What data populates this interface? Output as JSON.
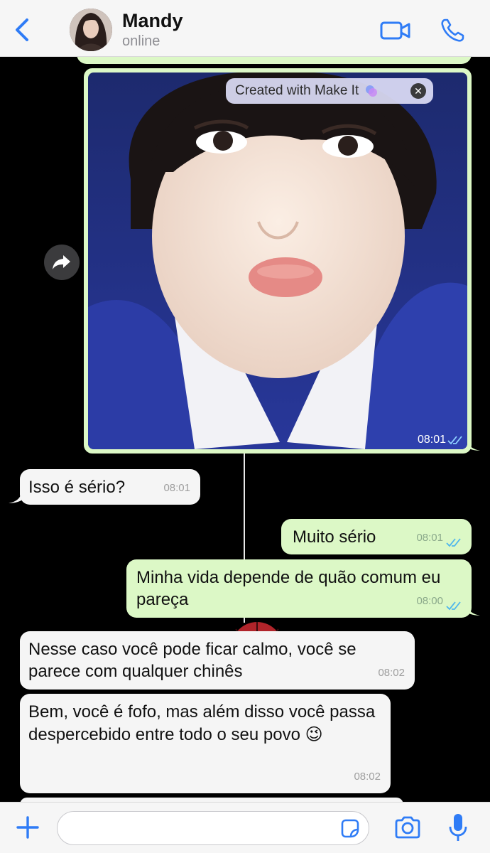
{
  "header": {
    "contact_name": "Mandy",
    "status": "online",
    "back_icon": "chevron-left-icon",
    "video_icon": "video-camera-icon",
    "phone_icon": "phone-icon",
    "accent_color": "#2f7cf6"
  },
  "image_message": {
    "badge_text": "Created with Make It",
    "time": "08:01",
    "status": "read"
  },
  "messages": [
    {
      "direction": "incoming",
      "text": "Isso é sério?",
      "time": "08:01"
    },
    {
      "direction": "outgoing",
      "text": "Muito sério",
      "time": "08:01",
      "status": "read"
    },
    {
      "direction": "outgoing",
      "text": "Minha vida depende de quão comum eu pareça",
      "time": "08:00",
      "status": "read"
    },
    {
      "direction": "incoming",
      "text": "Nesse caso você pode ficar calmo, você se parece com qualquer chinês",
      "time": "08:02"
    },
    {
      "direction": "incoming",
      "text": "Bem, você é fofo, mas além disso você passa despercebido entre todo o seu povo 😉",
      "time": "08:02"
    }
  ],
  "composer": {
    "value": "",
    "plus_icon": "plus-icon",
    "sticker_icon": "sticker-icon",
    "camera_icon": "camera-icon",
    "mic_icon": "microphone-icon"
  },
  "colors": {
    "outgoing_bubble": "#dcf8c6",
    "incoming_bubble": "#f5f5f5",
    "chat_background": "#000000",
    "read_tick": "#4fb6ec"
  }
}
